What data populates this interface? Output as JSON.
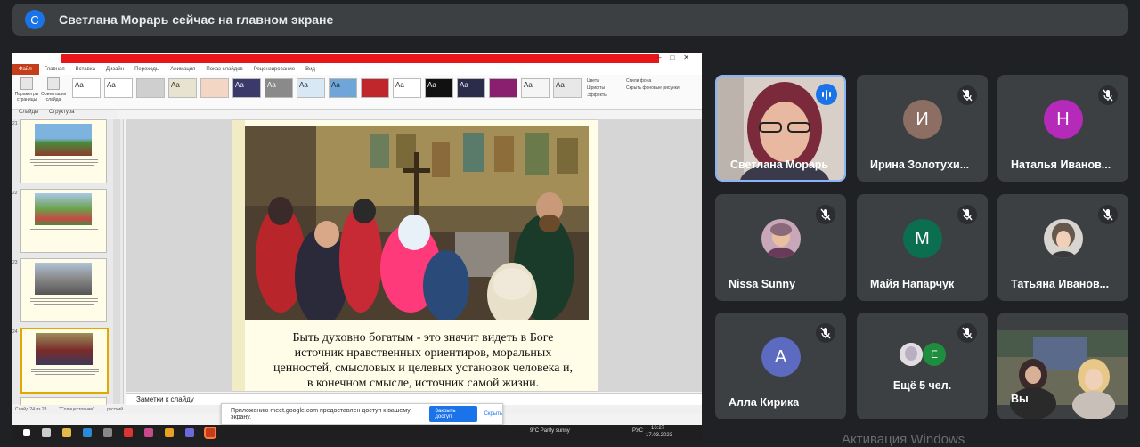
{
  "banner": {
    "avatar_letter": "С",
    "text": "Светлана Морарь сейчас на главном экране"
  },
  "presentation": {
    "menu": {
      "file": "Файл",
      "items": [
        "Главная",
        "Вставка",
        "Дизайн",
        "Переходы",
        "Анимация",
        "Показ слайдов",
        "Рецензирование",
        "Вид"
      ]
    },
    "ribbon_buttons": [
      "Параметры страницы",
      "Ориентация слайда"
    ],
    "theme_label": "Аа",
    "ribbon_right": [
      "Цвета",
      "Шрифты",
      "Эффекты",
      "Стили фона",
      "Скрыть фоновые рисунки"
    ],
    "pane_tabs": [
      "Слайды",
      "Структура"
    ],
    "thumb_numbers": [
      "21",
      "22",
      "23",
      "24"
    ],
    "slide_text": "Быть духовно богатым - это значит видеть в Боге источник нравственных ориентиров, моральных ценностей, смысловых и целевых установок человека и, в конечном смысле, источник самой жизни.",
    "notes_placeholder": "Заметки к слайду",
    "status_left": "Слайд 24 из 28",
    "status_theme": "\"Солнцестояние\"",
    "status_lang": "русский"
  },
  "share_bar": {
    "message": "Приложению meet.google.com предоставлен доступ к вашему экрану.",
    "stop_label": "Закрыть доступ",
    "hide_label": "Скрыть"
  },
  "taskbar": {
    "weather": "9°C  Partly sunny",
    "lang": "РУС",
    "time": "16:27",
    "date": "17.03.2023"
  },
  "watermark": "Активация Windows",
  "participants": [
    {
      "name": "Светлана Морарь",
      "type": "photo",
      "speaking": true
    },
    {
      "name": "Ирина Золотухи...",
      "initial": "И",
      "color": "#8d6e63",
      "muted": true
    },
    {
      "name": "Наталья Иванов...",
      "initial": "Н",
      "color": "#b52ab9",
      "muted": true
    },
    {
      "name": "Nissa Sunny",
      "type": "photo",
      "muted": true
    },
    {
      "name": "Майя Напарчук",
      "initial": "М",
      "color": "#0b6e4f",
      "muted": true
    },
    {
      "name": "Татьяна Иванов...",
      "type": "photo",
      "muted": true
    },
    {
      "name": "Алла Кирика",
      "initial": "А",
      "color": "#5c6bc0",
      "muted": true
    },
    {
      "name": "Ещё 5 чел.",
      "more_initial": "Е",
      "more_color": "#1e8e3e",
      "muted": true
    },
    {
      "name": "Вы",
      "type": "photo"
    }
  ]
}
